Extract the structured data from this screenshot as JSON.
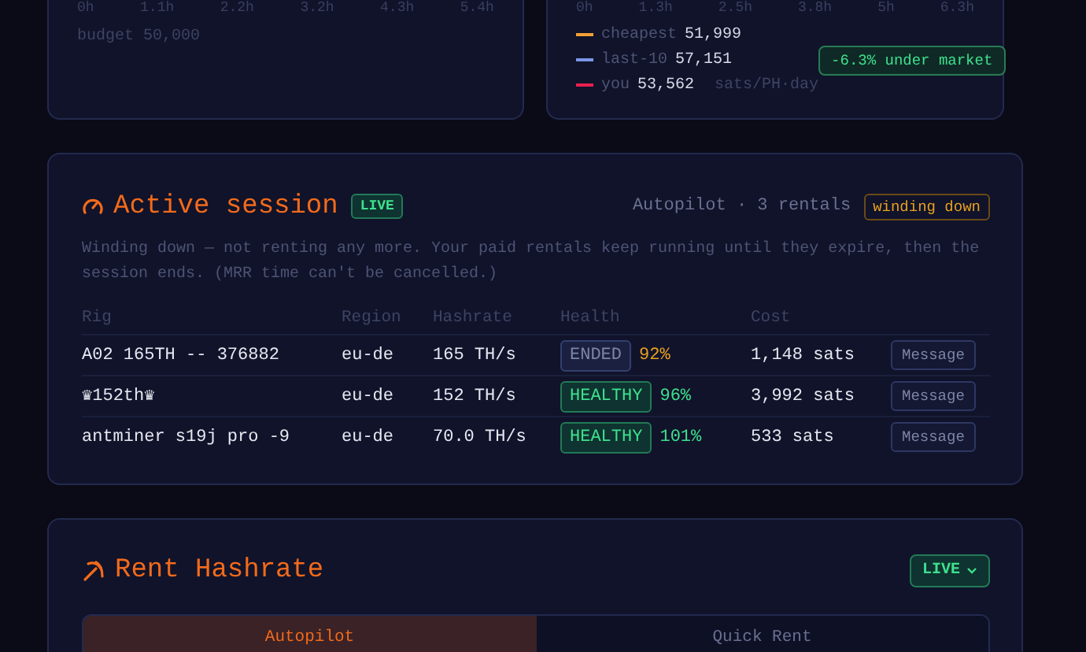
{
  "budget_chart": {
    "axis_labels": [
      "0h",
      "1.1h",
      "2.2h",
      "3.2h",
      "4.3h",
      "5.4h"
    ],
    "budget": "budget 50,000"
  },
  "price_chart": {
    "axis_labels": [
      "0h",
      "1.3h",
      "2.5h",
      "3.8h",
      "5h",
      "6.3h"
    ],
    "legend": [
      {
        "label": "cheapest",
        "value": "51,999",
        "color": "#f0a133"
      },
      {
        "label": "last-10",
        "value": "57,151",
        "color": "#7b96e8"
      },
      {
        "label": "you",
        "value": "53,562",
        "color": "#e8204f"
      }
    ],
    "unit": "sats/PH·day",
    "badge": "-6.3% under market"
  },
  "session": {
    "title": "Active session",
    "live_badge": "LIVE",
    "summary": "Autopilot · 3 rentals",
    "state_badge": "winding down",
    "note": "Winding down — not renting any more. Your paid rentals keep running until they expire, then the session ends. (MRR time can't be cancelled.)",
    "columns": [
      "Rig",
      "Region",
      "Hashrate",
      "Health",
      "Cost"
    ],
    "rows": [
      {
        "rig": "A02 165TH -- 376882",
        "region": "eu-de",
        "hashrate": "165 TH/s",
        "health": {
          "kind": "ended",
          "label": "ENDED",
          "percent": "92%",
          "warning": true
        },
        "cost": "1,148 sats",
        "action": "Message"
      },
      {
        "rig": "♛152th♛",
        "region": "eu-de",
        "hashrate": "152 TH/s",
        "health": {
          "kind": "healthy",
          "label": "HEALTHY",
          "percent": "96%",
          "warning": false
        },
        "cost": "3,992 sats",
        "action": "Message"
      },
      {
        "rig": "antminer s19j pro -9",
        "region": "eu-de",
        "hashrate": "70.0 TH/s",
        "health": {
          "kind": "healthy",
          "label": "HEALTHY",
          "percent": "101%",
          "warning": false
        },
        "cost": "533 sats",
        "action": "Message"
      }
    ]
  },
  "rent": {
    "title": "Rent Hashrate",
    "live_dropdown": "LIVE",
    "tabs": [
      {
        "label": "Autopilot",
        "selected": true
      },
      {
        "label": "Quick Rent",
        "selected": false
      }
    ]
  }
}
